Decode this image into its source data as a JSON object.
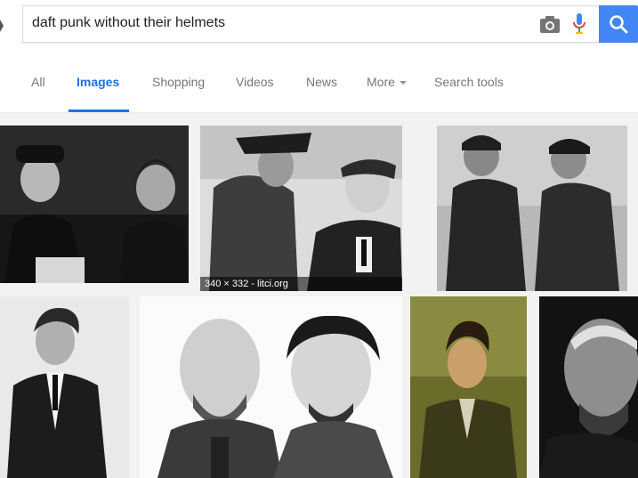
{
  "search": {
    "query": "daft punk without their helmets"
  },
  "tabs": [
    {
      "label": "All"
    },
    {
      "label": "Images",
      "active": true
    },
    {
      "label": "Shopping"
    },
    {
      "label": "Videos"
    },
    {
      "label": "News"
    },
    {
      "label": "More"
    },
    {
      "label": "Search tools"
    }
  ],
  "images": [
    {
      "tone": "dark-bw"
    },
    {
      "tone": "bw",
      "caption": "340 × 332 - litci.org"
    },
    {
      "tone": "bw"
    },
    {
      "tone": "bw-portrait"
    },
    {
      "tone": "white-bw"
    },
    {
      "tone": "olive-color"
    },
    {
      "tone": "dark-bw"
    }
  ],
  "colors": {
    "accent": "#1a73e8",
    "search_button": "#4285f4",
    "results_bg": "#f2f2f2"
  }
}
